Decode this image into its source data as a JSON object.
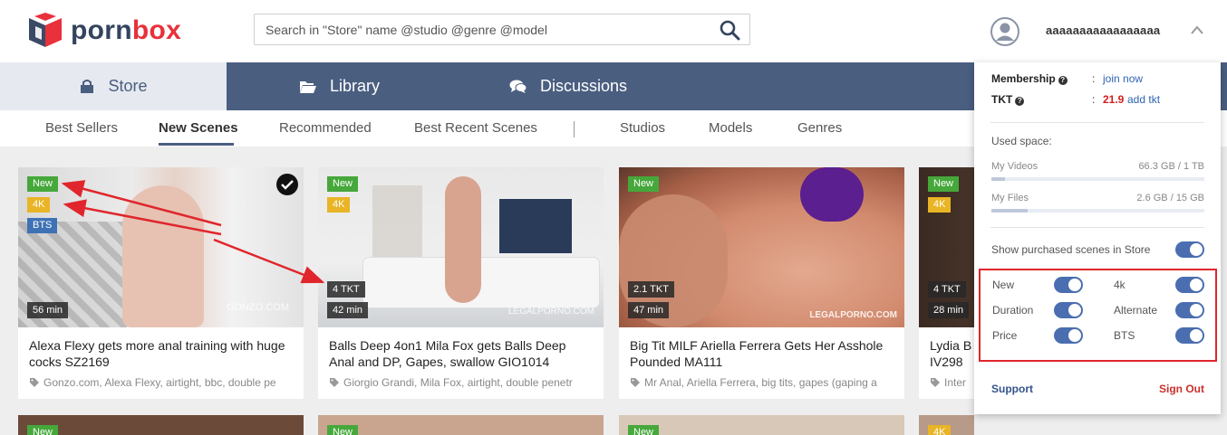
{
  "brand": {
    "part1": "porn",
    "part2": "box"
  },
  "search": {
    "placeholder": "Search in \"Store\" name @studio @genre @model"
  },
  "user": {
    "name": "aaaaaaaaaaaaaaaaa"
  },
  "main_nav": [
    {
      "label": "Store",
      "icon": "bag-icon",
      "active": true
    },
    {
      "label": "Library",
      "icon": "folder-open-icon",
      "active": false
    },
    {
      "label": "Discussions",
      "icon": "chat-bubbles-icon",
      "active": false
    }
  ],
  "sub_nav": [
    {
      "label": "Best Sellers"
    },
    {
      "label": "New Scenes",
      "active": true
    },
    {
      "label": "Recommended"
    },
    {
      "label": "Best Recent Scenes"
    },
    {
      "label": "Studios"
    },
    {
      "label": "Models"
    },
    {
      "label": "Genres"
    }
  ],
  "cards": [
    {
      "badges": [
        "New",
        "4K",
        "BTS"
      ],
      "tkt": "",
      "duration": "56 min",
      "watermark": "GONZO.COM",
      "purchased": true,
      "title": "Alexa Flexy gets more anal training with huge cocks SZ2169",
      "tags": "Gonzo.com, Alexa Flexy, airtight, bbc, double pe"
    },
    {
      "badges": [
        "New",
        "4K"
      ],
      "tkt": "4 TKT",
      "duration": "42 min",
      "watermark": "LEGALPORNO.COM",
      "purchased": false,
      "title": "Balls Deep 4on1 Mila Fox gets Balls Deep Anal and DP, Gapes, swallow GIO1014",
      "tags": "Giorgio Grandi, Mila Fox, airtight, double penetr"
    },
    {
      "badges": [
        "New"
      ],
      "tkt": "2.1 TKT",
      "duration": "47 min",
      "watermark": "LEGALPORNO.COM",
      "purchased": false,
      "title": "Big Tit MILF Ariella Ferrera Gets Her Asshole Pounded MA111",
      "tags": "Mr Anal, Ariella Ferrera, big tits, gapes (gaping a"
    },
    {
      "badges": [
        "New",
        "4K"
      ],
      "tkt": "4 TKT",
      "duration": "28 min",
      "watermark": "",
      "purchased": false,
      "title": "Lydia B\nIV298",
      "tags": "Inter"
    }
  ],
  "row2_badges": [
    "New",
    "New",
    "New",
    "4K"
  ],
  "panel": {
    "membership_label": "Membership",
    "membership_value": "join now",
    "tkt_label": "TKT",
    "tkt_amount": "21.9",
    "tkt_link": "add tkt",
    "colon": ":",
    "used_space_label": "Used space:",
    "my_videos_label": "My Videos",
    "my_videos_value": "66.3 GB / 1 TB",
    "my_videos_fraction": 0.065,
    "my_files_label": "My Files",
    "my_files_value": "2.6 GB / 15 GB",
    "my_files_fraction": 0.17,
    "show_purchased_label": "Show purchased scenes in Store",
    "toggles": [
      {
        "label": "New",
        "on": true
      },
      {
        "label": "4k",
        "on": true
      },
      {
        "label": "Duration",
        "on": true
      },
      {
        "label": "Alternate",
        "on": true
      },
      {
        "label": "Price",
        "on": true
      },
      {
        "label": "BTS",
        "on": true
      }
    ],
    "support_label": "Support",
    "signout_label": "Sign Out"
  },
  "colors": {
    "nav": "#4a5e80",
    "new_badge": "#46a83b",
    "k4_badge": "#e9b425",
    "bts_badge": "#3f72b5",
    "toggle": "#4a6eb0",
    "annotation": "#e0262c"
  }
}
